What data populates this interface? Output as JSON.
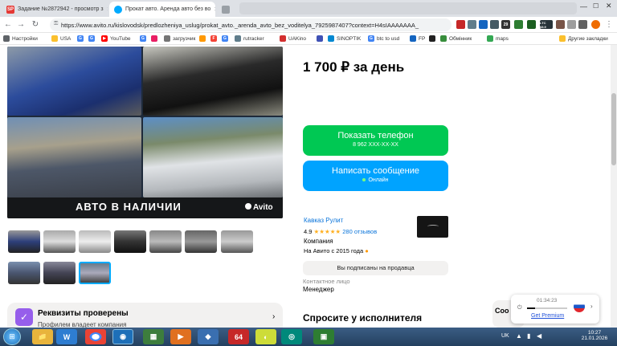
{
  "tabs": [
    {
      "label": "Задание №2872942 - просмотр з",
      "favicon": "SP"
    },
    {
      "label": "Прокат авто. Аренда авто без во",
      "favicon": "avito"
    },
    {
      "label": "",
      "favicon": "blank"
    }
  ],
  "toolbar": {
    "url": "https://www.avito.ru/kislovodsk/predlozheniya_uslug/prokat_avto._arenda_avto_bez_voditelya_7925987407?context=H4sIAAAAAAA_",
    "ext_badge_1": "29",
    "ext_badge_2": "LTC 68.9"
  },
  "bookmarks": [
    "Настройки",
    "USA",
    "YouTube",
    "загрузчик",
    "rutracker",
    "UAKino",
    "SINOPTIK",
    "btc to usd",
    "FP",
    "Обмінник",
    "maps",
    "Другие закладки"
  ],
  "listing": {
    "price": "1 700 ₽ за день",
    "banner_text": "АВТО В НАЛИЧИИ",
    "watermark": "Avito",
    "show_phone_label": "Показать телефон",
    "phone_masked": "8 962 XXX-XX-XX",
    "message_label": "Написать сообщение",
    "online_label": "Онлайн",
    "seller_name": "Кавказ Рулит",
    "rating": "4.9",
    "stars": "★★★★★",
    "reviews": "280 отзывов",
    "seller_type": "Компания",
    "since": "На Авито с 2015 года",
    "subscribed": "Вы подписаны на продавца",
    "contact_label": "Контактное лицо",
    "contact_role": "Менеджер",
    "verified_title": "Реквизиты проверены",
    "verified_sub": "Профилем владеет компания",
    "ask_title": "Спросите у исполнителя"
  },
  "vpn": {
    "timer": "01:34:23",
    "premium": "Get Premium"
  },
  "taskbar": {
    "lang": "UK",
    "time": "10:27",
    "date": "21.01.2026",
    "app_64": "64"
  },
  "colors": {
    "green": "#00c853",
    "blue": "#00a3ff",
    "link": "#0a74da"
  }
}
